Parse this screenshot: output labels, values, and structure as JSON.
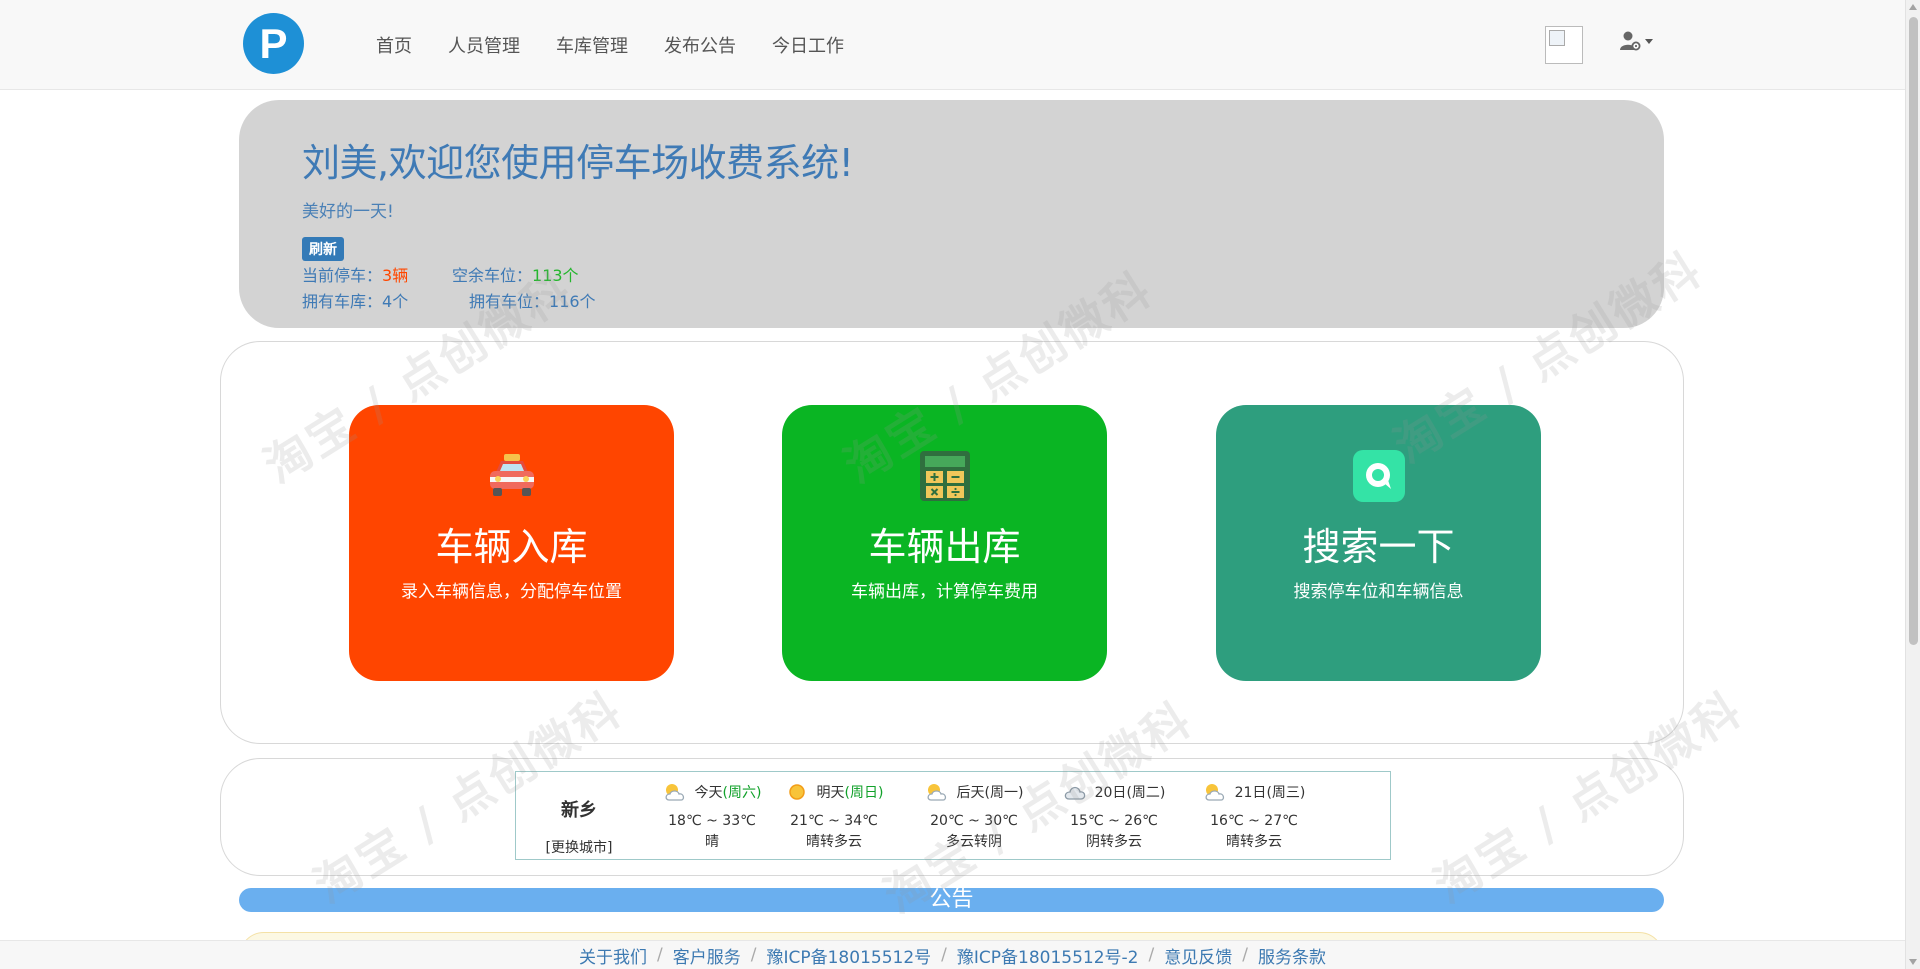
{
  "nav": {
    "items": [
      "首页",
      "人员管理",
      "车库管理",
      "发布公告",
      "今日工作"
    ]
  },
  "jumbotron": {
    "title": "刘美,欢迎您使用停车场收费系统!",
    "subtitle": "美好的一天!",
    "refresh_label": "刷新",
    "stats": {
      "current_parked_label": "当前停车：",
      "current_parked_value": "3辆",
      "free_spaces_label": "空余车位：",
      "free_spaces_value": "113个",
      "garages_label": "拥有车库：",
      "garages_value": "4个",
      "spaces_label": "拥有车位：",
      "spaces_value": "116个"
    }
  },
  "cards": [
    {
      "title": "车辆入库",
      "desc": "录入车辆信息，分配停车位置",
      "color": "#ff4500",
      "icon": "car-icon"
    },
    {
      "title": "车辆出库",
      "desc": "车辆出库，计算停车费用",
      "color": "#0ab523",
      "icon": "calculator-icon"
    },
    {
      "title": "搜索一下",
      "desc": "搜索停车位和车辆信息",
      "color": "#2e9e7e",
      "icon": "search-chat-icon"
    }
  ],
  "weather": {
    "city": "新乡",
    "change_city": "[更换城市]",
    "days": [
      {
        "label": "今天",
        "weekday": "(周六)",
        "temp": "18℃ ~ 33℃",
        "desc": "晴",
        "icon": "partly-cloudy-icon"
      },
      {
        "label": "明天",
        "weekday": "(周日)",
        "temp": "21℃ ~ 34℃",
        "desc": "晴转多云",
        "icon": "sun-icon"
      },
      {
        "label": "后天",
        "weekday": "(周一)",
        "temp": "20℃ ~ 30℃",
        "desc": "多云转阴",
        "icon": "partly-cloudy-icon"
      },
      {
        "label": "20日",
        "weekday": "(周二)",
        "temp": "15℃ ~ 26℃",
        "desc": "阴转多云",
        "icon": "cloud-icon"
      },
      {
        "label": "21日",
        "weekday": "(周三)",
        "temp": "16℃ ~ 27℃",
        "desc": "晴转多云",
        "icon": "partly-cloudy-icon"
      }
    ]
  },
  "notice": {
    "title": "公告"
  },
  "footer": {
    "links": [
      "关于我们",
      "客户服务",
      "豫ICP备18015512号",
      "豫ICP备18015512号-2",
      "意见反馈",
      "服务条款"
    ]
  },
  "watermark": "淘宝 / 点创微科",
  "colors": {
    "brand": "#1e90d6",
    "card_red": "#ff4500",
    "card_green": "#0ab523",
    "card_teal": "#2e9e7e",
    "jumbotron_bg": "#d3d3d3",
    "notice_bar": "#6aafef"
  }
}
